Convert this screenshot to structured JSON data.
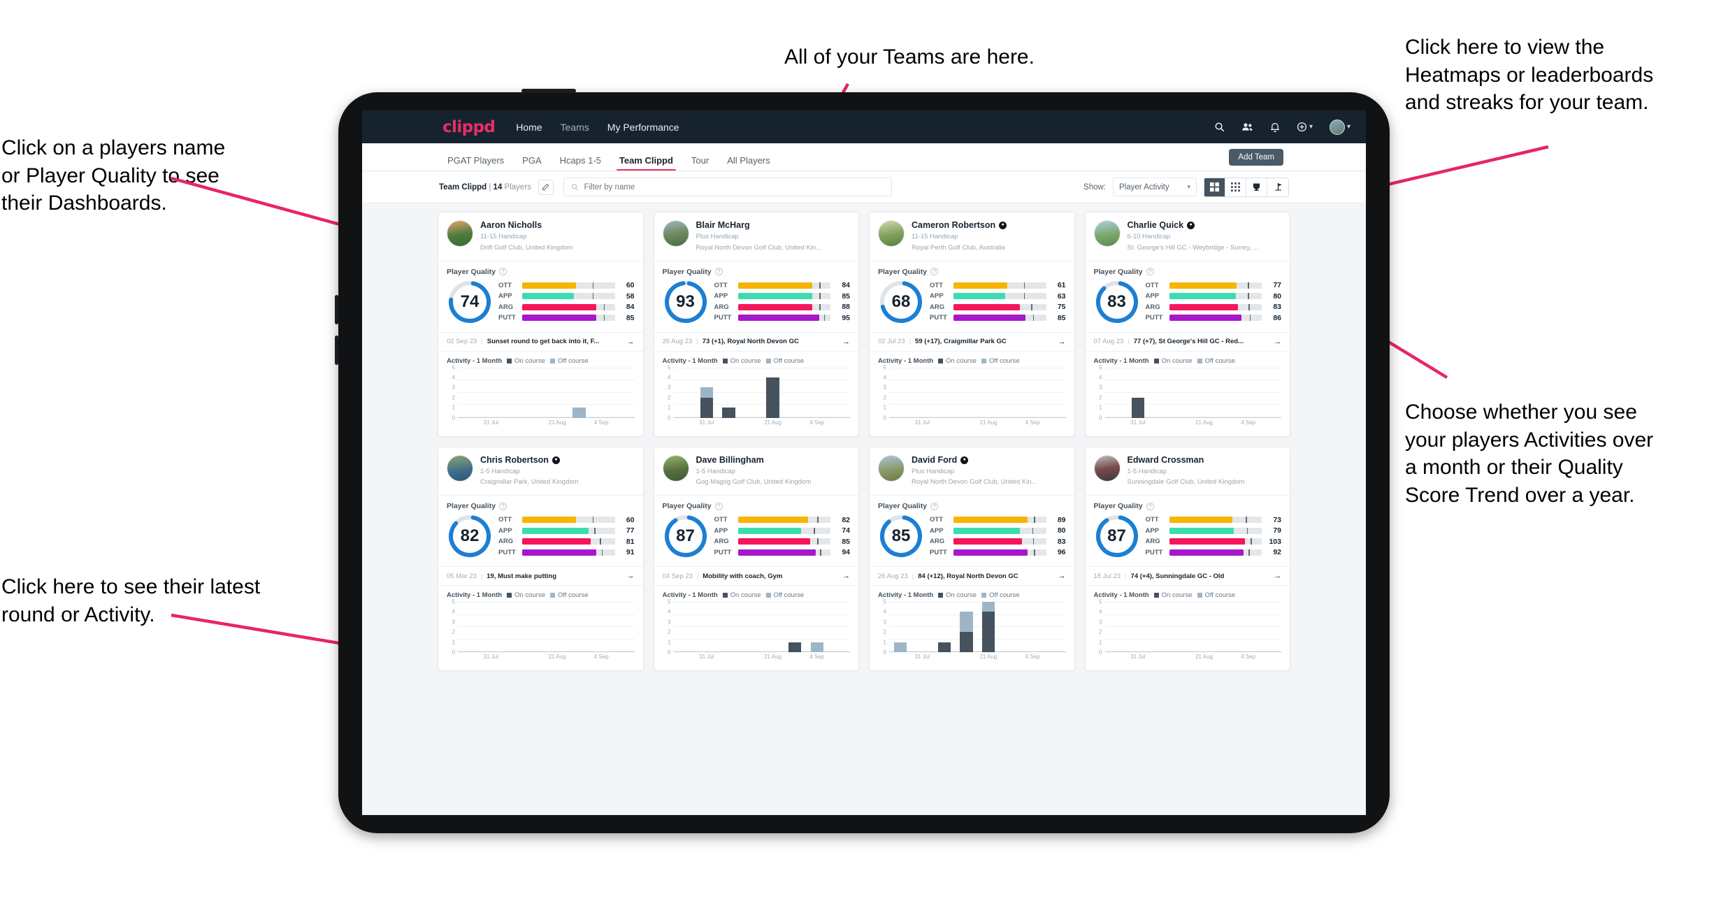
{
  "annotations": [
    {
      "id": "teams",
      "text": "All of your Teams are here."
    },
    {
      "id": "heatmaps",
      "text": "Click here to view the\nHeatmaps or leaderboards\nand streaks for your team."
    },
    {
      "id": "players",
      "text": "Click on a players name\nor Player Quality to see\ntheir Dashboards."
    },
    {
      "id": "activity",
      "text": "Choose whether you see\nyour players Activities over\na month or their Quality\nScore Trend over a year."
    },
    {
      "id": "latest",
      "text": "Click here to see their latest\nround or Activity."
    }
  ],
  "app": {
    "brand": "clippd",
    "nav_links": [
      {
        "label": "Home",
        "active": true
      },
      {
        "label": "Teams",
        "active": false
      },
      {
        "label": "My Performance",
        "active": true
      }
    ],
    "nav_icons": [
      "search-icon",
      "people-icon",
      "bell-icon",
      "plus-circle-icon",
      "avatar"
    ],
    "subnav_tabs": [
      {
        "label": "PGAT Players",
        "active": false
      },
      {
        "label": "PGA",
        "active": false
      },
      {
        "label": "Hcaps 1-5",
        "active": false
      },
      {
        "label": "Team Clippd",
        "active": true
      },
      {
        "label": "Tour",
        "active": false
      },
      {
        "label": "All Players",
        "active": false
      }
    ],
    "add_team_label": "Add Team",
    "filter": {
      "team_name": "Team Clippd",
      "player_count": "14",
      "players_word": "Players",
      "search_placeholder": "Filter by name",
      "search_value": "",
      "show_label": "Show:",
      "show_value": "Player Activity",
      "view_modes": [
        "grid-large-icon",
        "grid-small-icon",
        "trophy-icon",
        "flag-icon"
      ],
      "active_view": 0
    }
  },
  "colors": {
    "brand_pink": "#ec2c69",
    "nav_dark": "#16232f",
    "ott": "#f7b500",
    "app": "#3ddcb0",
    "arg": "#f5165c",
    "putt": "#a718c9",
    "ring": "#1b7fd4",
    "on_course": "#46525d",
    "off_course": "#9eb5c6"
  },
  "chart_common": {
    "title": "Activity - 1 Month",
    "legend": [
      "On course",
      "Off course"
    ],
    "ylabels": [
      "5",
      "4",
      "3",
      "2",
      "1",
      "0"
    ],
    "ymax": 5,
    "xlabels": [
      "31 Jul",
      "21 Aug",
      "4 Sep"
    ],
    "slots": 8,
    "type": "bar"
  },
  "quality_label": "Player Quality",
  "cards": [
    {
      "name": "Aaron Nicholls",
      "verified": false,
      "handicap": "11-15 Handicap",
      "club": "Drift Golf Club, United Kingdom",
      "avatar": "linear-gradient(170deg,#e9a06a 0%,#4b7c3c 55%,#3d6b33 100%)",
      "score": 74,
      "ring_pct": 74,
      "metrics": [
        {
          "label": "OTT",
          "value": 60,
          "fill": 58,
          "tick": 76
        },
        {
          "label": "APP",
          "value": 58,
          "fill": 56,
          "tick": 76
        },
        {
          "label": "ARG",
          "value": 84,
          "fill": 80,
          "tick": 88
        },
        {
          "label": "PUTT",
          "value": 85,
          "fill": 80,
          "tick": 88
        }
      ],
      "round_date": "02 Sep 23",
      "round_text": "Sunset round to get back into it, F...",
      "chart": {
        "on": [
          0,
          0,
          0,
          0,
          0,
          0,
          0,
          0
        ],
        "off": [
          0,
          0,
          0,
          0,
          0,
          1,
          0,
          0
        ]
      }
    },
    {
      "name": "Blair McHarg",
      "verified": false,
      "handicap": "Plus Handicap",
      "club": "Royal North Devon Golf Club, United Kin...",
      "avatar": "linear-gradient(170deg,#9fb8c9 0%,#6f8a5e 50%,#4e6b43 100%)",
      "score": 93,
      "ring_pct": 95,
      "metrics": [
        {
          "label": "OTT",
          "value": 84,
          "fill": 80,
          "tick": 88
        },
        {
          "label": "APP",
          "value": 85,
          "fill": 80,
          "tick": 88
        },
        {
          "label": "ARG",
          "value": 88,
          "fill": 80,
          "tick": 88
        },
        {
          "label": "PUTT",
          "value": 95,
          "fill": 88,
          "tick": 93
        }
      ],
      "round_date": "26 Aug 23",
      "round_text": "73 (+1), Royal North Devon GC",
      "chart": {
        "on": [
          0,
          2,
          1,
          0,
          4,
          0,
          0,
          0
        ],
        "off": [
          0,
          1,
          0,
          0,
          0,
          0,
          0,
          0
        ]
      }
    },
    {
      "name": "Cameron Robertson",
      "verified": true,
      "handicap": "11-15 Handicap",
      "club": "Royal Perth Golf Club, Australia",
      "avatar": "linear-gradient(170deg,#cfd8a8 0%,#7fa05c 55%,#5d7f48 100%)",
      "score": 68,
      "ring_pct": 68,
      "metrics": [
        {
          "label": "OTT",
          "value": 61,
          "fill": 58,
          "tick": 76
        },
        {
          "label": "APP",
          "value": 63,
          "fill": 56,
          "tick": 76
        },
        {
          "label": "ARG",
          "value": 75,
          "fill": 72,
          "tick": 84
        },
        {
          "label": "PUTT",
          "value": 85,
          "fill": 78,
          "tick": 86
        }
      ],
      "round_date": "02 Jul 23",
      "round_text": "59 (+17), Craigmillar Park GC",
      "chart": {
        "on": [
          0,
          0,
          0,
          0,
          0,
          0,
          0,
          0
        ],
        "off": [
          0,
          0,
          0,
          0,
          0,
          0,
          0,
          0
        ]
      }
    },
    {
      "name": "Charlie Quick",
      "verified": true,
      "handicap": "6-10 Handicap",
      "club": "St. George's Hill GC - Weybridge - Surrey, ...",
      "avatar": "linear-gradient(170deg,#aecfe6 0%,#7aa86a 55%,#5b8a4c 100%)",
      "score": 83,
      "ring_pct": 85,
      "metrics": [
        {
          "label": "OTT",
          "value": 77,
          "fill": 73,
          "tick": 85
        },
        {
          "label": "APP",
          "value": 80,
          "fill": 72,
          "tick": 85
        },
        {
          "label": "ARG",
          "value": 83,
          "fill": 74,
          "tick": 86
        },
        {
          "label": "PUTT",
          "value": 86,
          "fill": 78,
          "tick": 87
        }
      ],
      "round_date": "07 Aug 23",
      "round_text": "77 (+7), St George's Hill GC - Red...",
      "chart": {
        "on": [
          0,
          2,
          0,
          0,
          0,
          0,
          0,
          0
        ],
        "off": [
          0,
          0,
          0,
          0,
          0,
          0,
          0,
          0
        ]
      }
    },
    {
      "name": "Chris Robertson",
      "verified": true,
      "handicap": "1-5 Handicap",
      "club": "Craigmillar Park, United Kingdom",
      "avatar": "linear-gradient(170deg,#87a86a 0%,#3f6b8e 60%,#2f5572 100%)",
      "score": 82,
      "ring_pct": 84,
      "metrics": [
        {
          "label": "OTT",
          "value": 60,
          "fill": 58,
          "tick": 76
        },
        {
          "label": "APP",
          "value": 77,
          "fill": 72,
          "tick": 78
        },
        {
          "label": "ARG",
          "value": 81,
          "fill": 74,
          "tick": 84
        },
        {
          "label": "PUTT",
          "value": 91,
          "fill": 80,
          "tick": 86
        }
      ],
      "round_date": "05 Mar 23",
      "round_text": "19, Must make putting",
      "chart": {
        "on": [
          0,
          0,
          0,
          0,
          0,
          0,
          0,
          0
        ],
        "off": [
          0,
          0,
          0,
          0,
          0,
          0,
          0,
          0
        ]
      }
    },
    {
      "name": "Dave Billingham",
      "verified": false,
      "handicap": "1-5 Handicap",
      "club": "Gog Magog Golf Club, United Kingdom",
      "avatar": "linear-gradient(170deg,#9ab36f 0%,#56713f 55%,#3e5a33 100%)",
      "score": 87,
      "ring_pct": 88,
      "metrics": [
        {
          "label": "OTT",
          "value": 82,
          "fill": 76,
          "tick": 86
        },
        {
          "label": "APP",
          "value": 74,
          "fill": 68,
          "tick": 82
        },
        {
          "label": "ARG",
          "value": 85,
          "fill": 78,
          "tick": 86
        },
        {
          "label": "PUTT",
          "value": 94,
          "fill": 84,
          "tick": 89
        }
      ],
      "round_date": "04 Sep 23",
      "round_text": "Mobility with coach, Gym",
      "chart": {
        "on": [
          0,
          0,
          0,
          0,
          0,
          1,
          0,
          0
        ],
        "off": [
          0,
          0,
          0,
          0,
          0,
          0,
          1,
          0
        ]
      }
    },
    {
      "name": "David Ford",
      "verified": true,
      "handicap": "Plus Handicap",
      "club": "Royal North Devon Golf Club, United Kin...",
      "avatar": "linear-gradient(170deg,#a9c6d8 0%,#8a9a6a 55%,#6a7a4a 100%)",
      "score": 85,
      "ring_pct": 86,
      "metrics": [
        {
          "label": "OTT",
          "value": 89,
          "fill": 80,
          "tick": 87
        },
        {
          "label": "APP",
          "value": 80,
          "fill": 72,
          "tick": 85
        },
        {
          "label": "ARG",
          "value": 83,
          "fill": 74,
          "tick": 86
        },
        {
          "label": "PUTT",
          "value": 96,
          "fill": 80,
          "tick": 87
        }
      ],
      "round_date": "26 Aug 23",
      "round_text": "84 (+12), Royal North Devon GC",
      "chart": {
        "on": [
          0,
          0,
          1,
          2,
          4,
          0,
          0,
          0
        ],
        "off": [
          1,
          0,
          0,
          2,
          1,
          0,
          0,
          0
        ]
      }
    },
    {
      "name": "Edward Crossman",
      "verified": false,
      "handicap": "1-5 Handicap",
      "club": "Sunningdale Golf Club, United Kingdom",
      "avatar": "linear-gradient(170deg,#c0c0c4 0%,#7a4a4a 50%,#3a3a42 100%)",
      "score": 87,
      "ring_pct": 88,
      "metrics": [
        {
          "label": "OTT",
          "value": 73,
          "fill": 68,
          "tick": 83
        },
        {
          "label": "APP",
          "value": 79,
          "fill": 70,
          "tick": 84
        },
        {
          "label": "ARG",
          "value": 103,
          "fill": 82,
          "tick": 88
        },
        {
          "label": "PUTT",
          "value": 92,
          "fill": 80,
          "tick": 86
        }
      ],
      "round_date": "18 Jul 23",
      "round_text": "74 (+4), Sunningdale GC - Old",
      "chart": {
        "on": [
          0,
          0,
          0,
          0,
          0,
          0,
          0,
          0
        ],
        "off": [
          0,
          0,
          0,
          0,
          0,
          0,
          0,
          0
        ]
      }
    }
  ]
}
